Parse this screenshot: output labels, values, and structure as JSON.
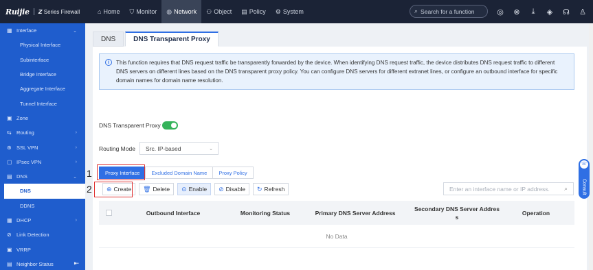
{
  "header": {
    "brand": "Ruijie",
    "product": "Series Firewall",
    "product_mark": "Z",
    "nav": [
      {
        "label": "Home",
        "icon": "home-icon",
        "glyph": "⌂"
      },
      {
        "label": "Monitor",
        "icon": "shield-icon",
        "glyph": "⛉"
      },
      {
        "label": "Network",
        "icon": "globe-icon",
        "glyph": "◍"
      },
      {
        "label": "Object",
        "icon": "users-icon",
        "glyph": "⚇"
      },
      {
        "label": "Policy",
        "icon": "document-icon",
        "glyph": "▤"
      },
      {
        "label": "System",
        "icon": "gear-icon",
        "glyph": "⚙"
      }
    ],
    "search_placeholder": "Search for a function",
    "icons": [
      "wireless-icon",
      "network-icon",
      "download-icon",
      "compass-icon",
      "headset-icon",
      "user-icon"
    ]
  },
  "sidebar": {
    "items": [
      {
        "label": "Interface",
        "type": "group",
        "icon": "grid-icon",
        "glyph": "▦",
        "chevron": "⌄"
      },
      {
        "label": "Physical Interface",
        "type": "sub"
      },
      {
        "label": "Subinterface",
        "type": "sub"
      },
      {
        "label": "Bridge Interface",
        "type": "sub"
      },
      {
        "label": "Aggregate Interface",
        "type": "sub"
      },
      {
        "label": "Tunnel Interface",
        "type": "sub"
      },
      {
        "label": "Zone",
        "type": "group",
        "icon": "zone-icon",
        "glyph": "▣",
        "chevron": ""
      },
      {
        "label": "Routing",
        "type": "group",
        "icon": "route-icon",
        "glyph": "⇆",
        "chevron": "›"
      },
      {
        "label": "SSL VPN",
        "type": "group",
        "icon": "vpn-icon",
        "glyph": "⊛",
        "chevron": "›"
      },
      {
        "label": "IPsec VPN",
        "type": "group",
        "icon": "lock-icon",
        "glyph": "▢",
        "chevron": "›"
      },
      {
        "label": "DNS",
        "type": "group",
        "icon": "dns-icon",
        "glyph": "▤",
        "chevron": "⌄"
      },
      {
        "label": "DNS",
        "type": "sub-active"
      },
      {
        "label": "DDNS",
        "type": "sub"
      },
      {
        "label": "DHCP",
        "type": "group",
        "icon": "dhcp-icon",
        "glyph": "▦",
        "chevron": "›"
      },
      {
        "label": "Link Detection",
        "type": "group",
        "icon": "link-icon",
        "glyph": "⊘",
        "chevron": ""
      },
      {
        "label": "VRRP",
        "type": "group",
        "icon": "vrrp-icon",
        "glyph": "▣",
        "chevron": ""
      },
      {
        "label": "Neighbor Status",
        "type": "group",
        "icon": "neighbor-icon",
        "glyph": "▤",
        "chevron": ""
      }
    ],
    "collapse_glyph": "⇤"
  },
  "tabs": [
    "DNS",
    "DNS Transparent Proxy"
  ],
  "info_text": "This function requires that DNS request traffic be transparently forwarded by the device. When identifying DNS request traffic, the device distributes DNS request traffic to different DNS servers on different lines based on the DNS transparent proxy policy. You can configure DNS servers for different extranet lines, or configure an outbound interface for specific domain names for domain name resolution.",
  "proxy_toggle": {
    "label": "DNS Transparent Proxy",
    "enabled": true
  },
  "routing_mode": {
    "label": "Routing Mode",
    "value": "Src. IP-based"
  },
  "subtabs": [
    "Proxy Interface",
    "Excluded Domain Name",
    "Proxy Policy"
  ],
  "toolbar": {
    "create": "Create",
    "delete": "Delete",
    "enable": "Enable",
    "disable": "Disable",
    "refresh": "Refresh"
  },
  "table_search_placeholder": "Enter an interface name or IP address.",
  "table": {
    "columns": [
      "Outbound Interface",
      "Monitoring Status",
      "Primary DNS Server Address",
      "Secondary DNS Server Address",
      "Operation"
    ],
    "empty_text": "No Data"
  },
  "annotations": {
    "step1": "1",
    "step2": "2"
  },
  "consult_label": "Consult",
  "colors": {
    "topbar": "#1b2336",
    "sidebar": "#1f5dcd",
    "accent": "#2f6fe4",
    "toggle_on": "#35b35a",
    "highlight": "#e03131"
  }
}
